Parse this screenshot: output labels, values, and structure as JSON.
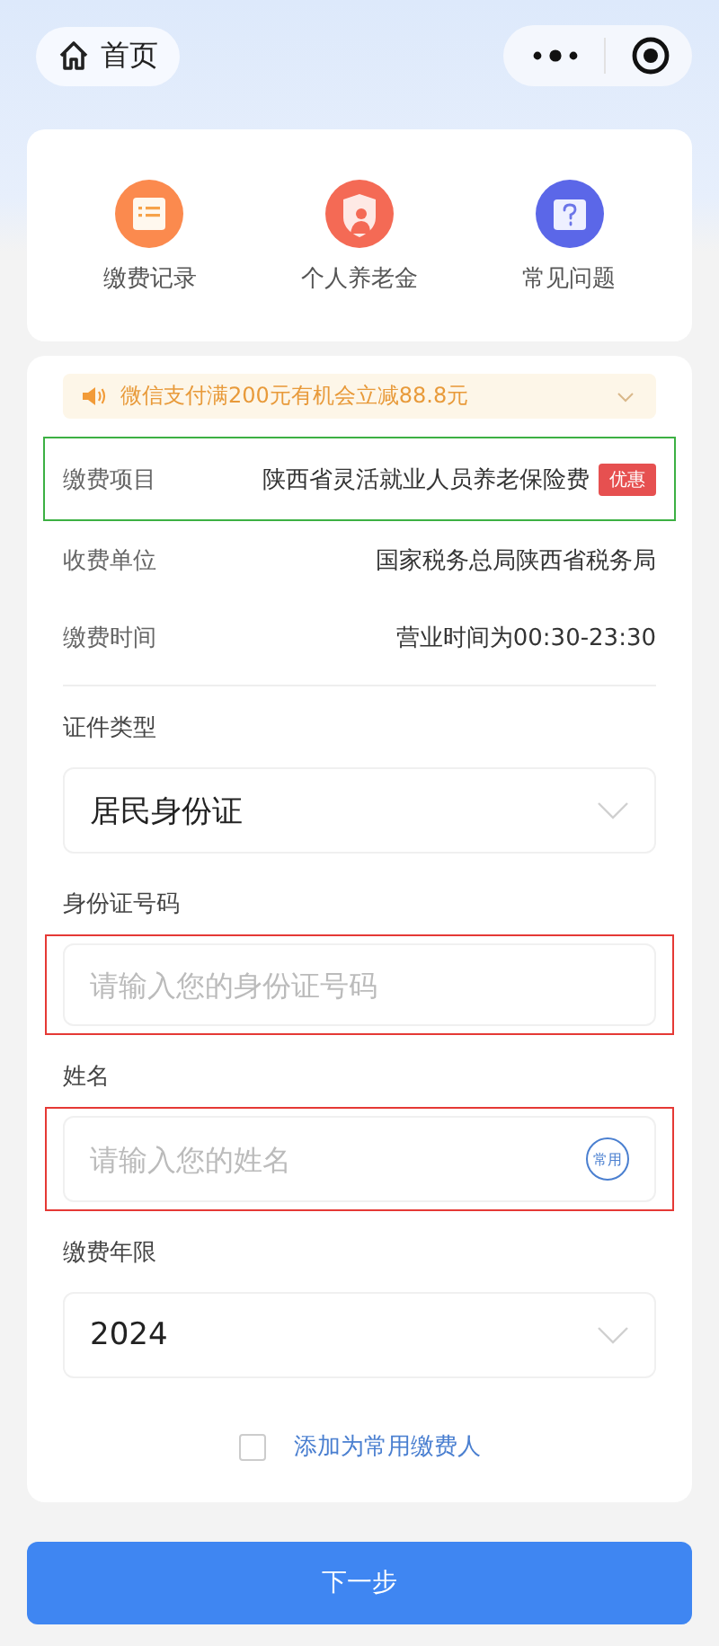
{
  "nav": {
    "home_label": "首页"
  },
  "shortcuts": [
    {
      "label": "缴费记录",
      "kind": "records",
      "color": "#fb8a4e"
    },
    {
      "label": "个人养老金",
      "kind": "pension",
      "color": "#f46a55"
    },
    {
      "label": "常见问题",
      "kind": "faq",
      "color": "#5b67e8"
    }
  ],
  "notice": {
    "text": "微信支付满200元有机会立减88.8元"
  },
  "info_rows": [
    {
      "label": "缴费项目",
      "value": "陕西省灵活就业人员养老保险费",
      "badge": "优惠",
      "annotation": {
        "color": "#3cb043"
      }
    },
    {
      "label": "收费单位",
      "value": "国家税务总局陕西省税务局"
    },
    {
      "label": "缴费时间",
      "value": "营业时间为00:30-23:30"
    }
  ],
  "fields": [
    {
      "label": "证件类型",
      "kind": "select",
      "value": "居民身份证"
    },
    {
      "label": "身份证号码",
      "kind": "input",
      "placeholder": "请输入您的身份证号码",
      "annotation": {
        "color": "#e53935"
      }
    },
    {
      "label": "姓名",
      "kind": "input",
      "placeholder": "请输入您的姓名",
      "tag": "常用",
      "annotation": {
        "color": "#e53935"
      }
    },
    {
      "label": "缴费年限",
      "kind": "select",
      "value": "2024"
    }
  ],
  "save_payer": {
    "label": "添加为常用缴费人",
    "checked": false
  },
  "submit": {
    "label": "下一步"
  }
}
